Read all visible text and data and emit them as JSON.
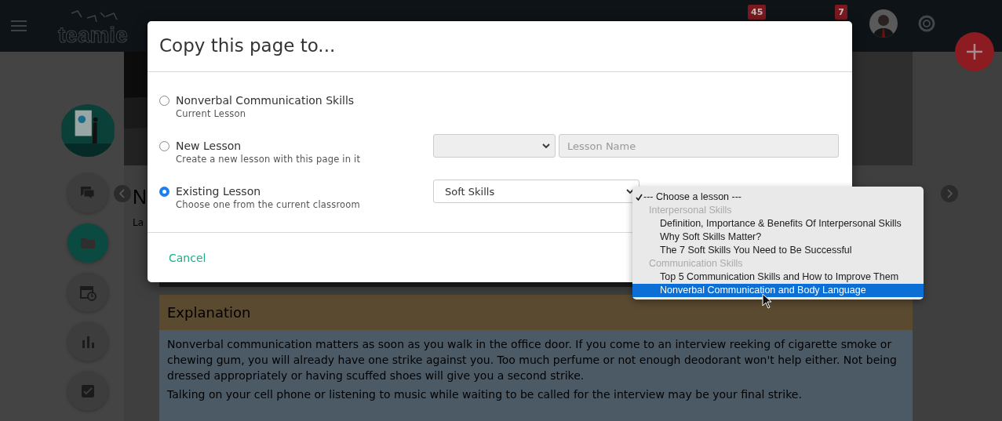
{
  "top_bar": {
    "logo": "teamie",
    "badges": [
      {
        "count": "45"
      },
      {
        "count": "7"
      }
    ]
  },
  "sidebar": {
    "items": [
      {
        "kind": "chat",
        "selected": false
      },
      {
        "kind": "folder",
        "selected": true
      },
      {
        "kind": "calendar",
        "selected": false
      },
      {
        "kind": "chart",
        "selected": false
      },
      {
        "kind": "check",
        "selected": false
      }
    ]
  },
  "page": {
    "title": "N",
    "subtitle": "La",
    "section": {
      "heading": "Explanation",
      "paragraphs": [
        "Nonverbal communication matters as soon as you walk in the office door. If you come to an interview reeking of cigarette smoke or chewing gum, you will already have one strike against you. Too much perfume or not enough deodorant won't help either. Not being dressed appropriately or having scuffed shoes will give you a second strike.",
        "Talking on your cell phone or listening to music while waiting to be called for the interview may be your final strike."
      ]
    }
  },
  "dialog": {
    "title": "Copy this page to...",
    "options": [
      {
        "kind": "current",
        "label": "Nonverbal Communication Skills",
        "description": "Current Lesson",
        "selected": false
      },
      {
        "kind": "new",
        "label": "New Lesson",
        "description": "Create a new lesson with this page in it",
        "selected": false
      },
      {
        "kind": "existing",
        "label": "Existing Lesson",
        "description": "Choose one from the current classroom",
        "selected": true
      }
    ],
    "new_lesson": {
      "placeholder": "Lesson Name"
    },
    "existing_lesson": {
      "classroom": "Soft Skills"
    },
    "cancel": "Cancel"
  },
  "dropdown": {
    "items": [
      {
        "kind": "option",
        "label": "--- Choose a lesson ---",
        "checked": true,
        "selected": false
      },
      {
        "kind": "group",
        "label": "Interpersonal Skills",
        "options": [
          {
            "label": "Definition, Importance & Benefits Of Interpersonal Skills",
            "checked": false,
            "selected": false
          },
          {
            "label": "Why Soft Skills Matter?",
            "checked": false,
            "selected": false
          },
          {
            "label": "The 7 Soft Skills You Need to Be Successful",
            "checked": false,
            "selected": false
          }
        ]
      },
      {
        "kind": "group",
        "label": "Communication Skills",
        "options": [
          {
            "label": "Top 5 Communication Skills and How to Improve Them",
            "checked": false,
            "selected": false
          },
          {
            "label": "Nonverbal Communication and Body Language",
            "checked": false,
            "selected": true
          }
        ]
      }
    ]
  }
}
